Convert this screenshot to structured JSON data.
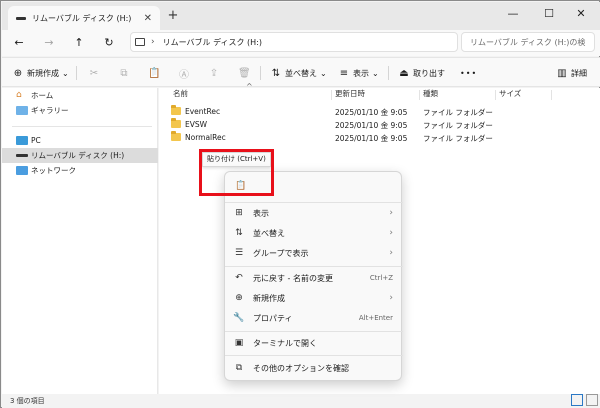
{
  "window": {
    "tab_title": "リムーバブル ディスク (H:)",
    "new_tab": "+",
    "minimize": "—",
    "maximize": "☐",
    "close": "✕",
    "tab_close": "✕"
  },
  "nav": {
    "back": "←",
    "forward": "→",
    "up": "↑",
    "refresh": "↻",
    "chevron": "›",
    "address": "リムーバブル ディスク (H:)",
    "search_placeholder": "リムーバブル ディスク (H:)の検"
  },
  "toolbar": {
    "new_label": "新規作成",
    "new_icon": "⊕",
    "sort_label": "並べ替え",
    "sort_icon": "⇅",
    "view_label": "表示",
    "view_icon": "≡",
    "eject_label": "取り出す",
    "eject_icon": "⏏",
    "more": "•••",
    "details_label": "詳細",
    "dropdown": "⌄"
  },
  "sidebar": {
    "items": [
      {
        "label": "ホーム"
      },
      {
        "label": "ギャラリー"
      },
      {
        "label": "PC"
      },
      {
        "label": "リムーバブル ディスク (H:)"
      },
      {
        "label": "ネットワーク"
      }
    ]
  },
  "columns": {
    "name": "名前",
    "modified": "更新日時",
    "type": "種類",
    "size": "サイズ"
  },
  "files": [
    {
      "name": "EventRec",
      "date": "2025/01/10 金 9:05",
      "type": "ファイル フォルダー"
    },
    {
      "name": "EVSW",
      "date": "2025/01/10 金 9:05",
      "type": "ファイル フォルダー"
    },
    {
      "name": "NormalRec",
      "date": "2025/01/10 金 9:05",
      "type": "ファイル フォルダー"
    }
  ],
  "tooltip": "貼り付け (Ctrl+V)",
  "context_menu": {
    "paste_icon": "📋",
    "items": [
      {
        "icon": "⊞",
        "label": "表示",
        "arrow": "›"
      },
      {
        "icon": "⇅",
        "label": "並べ替え",
        "arrow": "›"
      },
      {
        "icon": "☰",
        "label": "グループで表示",
        "arrow": "›"
      },
      {
        "icon": "↶",
        "label": "元に戻す - 名前の変更",
        "shortcut": "Ctrl+Z"
      },
      {
        "icon": "⊕",
        "label": "新規作成",
        "arrow": "›"
      },
      {
        "icon": "🔧",
        "label": "プロパティ",
        "shortcut": "Alt+Enter"
      },
      {
        "icon": "▣",
        "label": "ターミナルで開く"
      },
      {
        "icon": "⧉",
        "label": "その他のオプションを確認"
      }
    ]
  },
  "status": {
    "count": "3 個の項目"
  },
  "colors": {
    "highlight": "#e8101a",
    "folder": "#f3c64d",
    "selected": "#dcdcdc"
  }
}
